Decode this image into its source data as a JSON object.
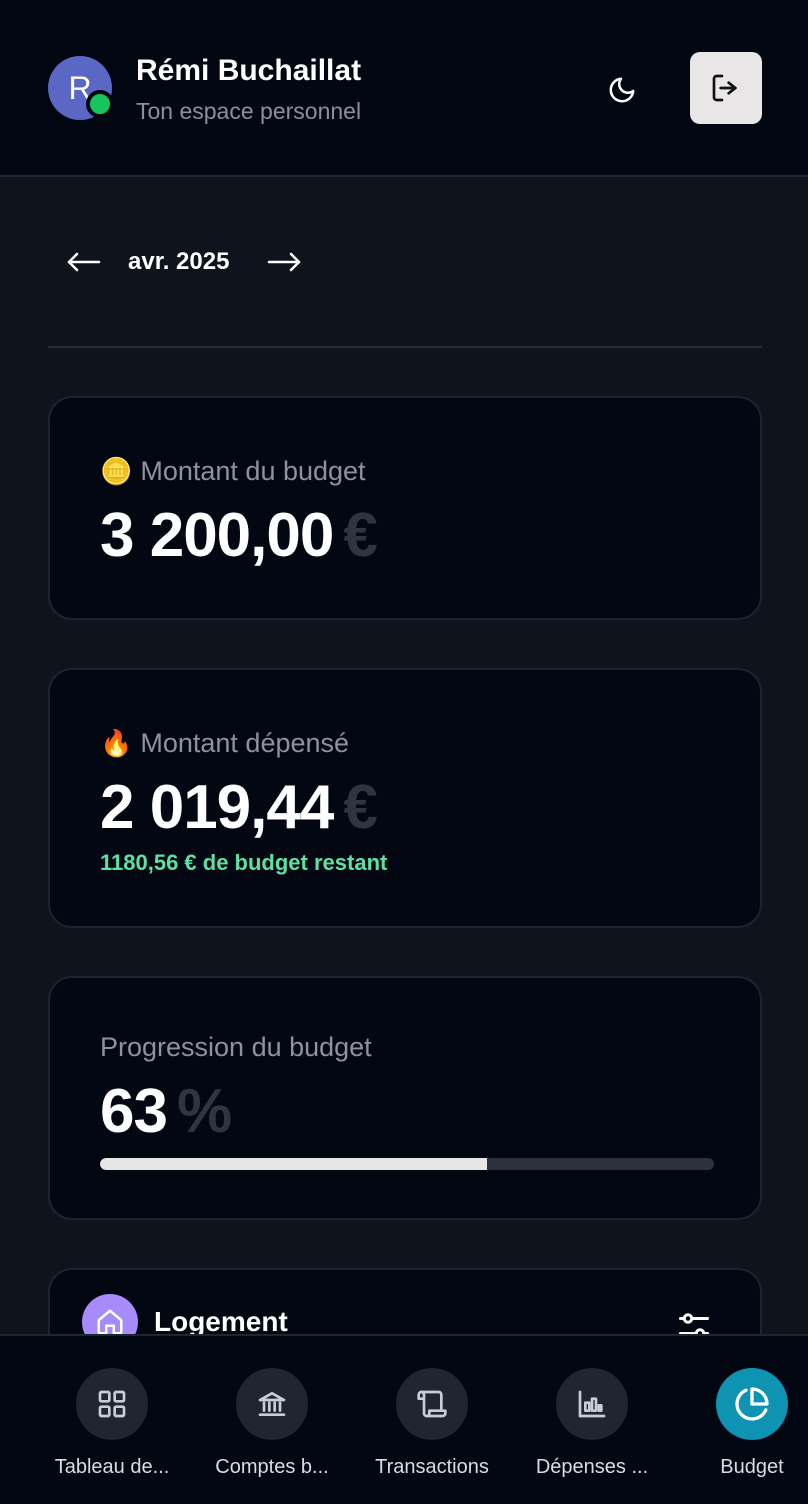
{
  "header": {
    "avatar_initial": "R",
    "user_name": "Rémi Buchaillat",
    "subtitle": "Ton espace personnel",
    "theme_icon": "moon-icon",
    "logout_icon": "logout-icon"
  },
  "month_nav": {
    "prev_arrow": "←",
    "label": "avr. 2025",
    "next_arrow": "→"
  },
  "budget_card": {
    "emoji": "🪙",
    "label": "Montant du budget",
    "amount": "3 200,00",
    "currency": "€"
  },
  "spent_card": {
    "emoji": "🔥",
    "label": "Montant dépensé",
    "amount": "2 019,44",
    "currency": "€",
    "remaining_text": "1180,56 € de budget restant"
  },
  "progress_card": {
    "label": "Progression du budget",
    "value": "63",
    "unit": "%",
    "percent": 63
  },
  "category_card": {
    "label": "Logement",
    "icon": "home-icon",
    "filter_icon": "filter-icon"
  },
  "bottom_nav": {
    "items": [
      {
        "label": "Tableau de...",
        "icon": "dashboard-icon",
        "active": false
      },
      {
        "label": "Comptes b...",
        "icon": "bank-icon",
        "active": false
      },
      {
        "label": "Transactions",
        "icon": "scroll-icon",
        "active": false
      },
      {
        "label": "Dépenses ...",
        "icon": "chart-icon",
        "active": false
      },
      {
        "label": "Budget",
        "icon": "pie-chart-icon",
        "active": true
      }
    ]
  },
  "colors": {
    "background": "#0f141c",
    "card": "#030712",
    "accent": "#0e93b2",
    "success": "#5ee0a5",
    "online": "#16c55e",
    "category": "#a78bfa"
  }
}
